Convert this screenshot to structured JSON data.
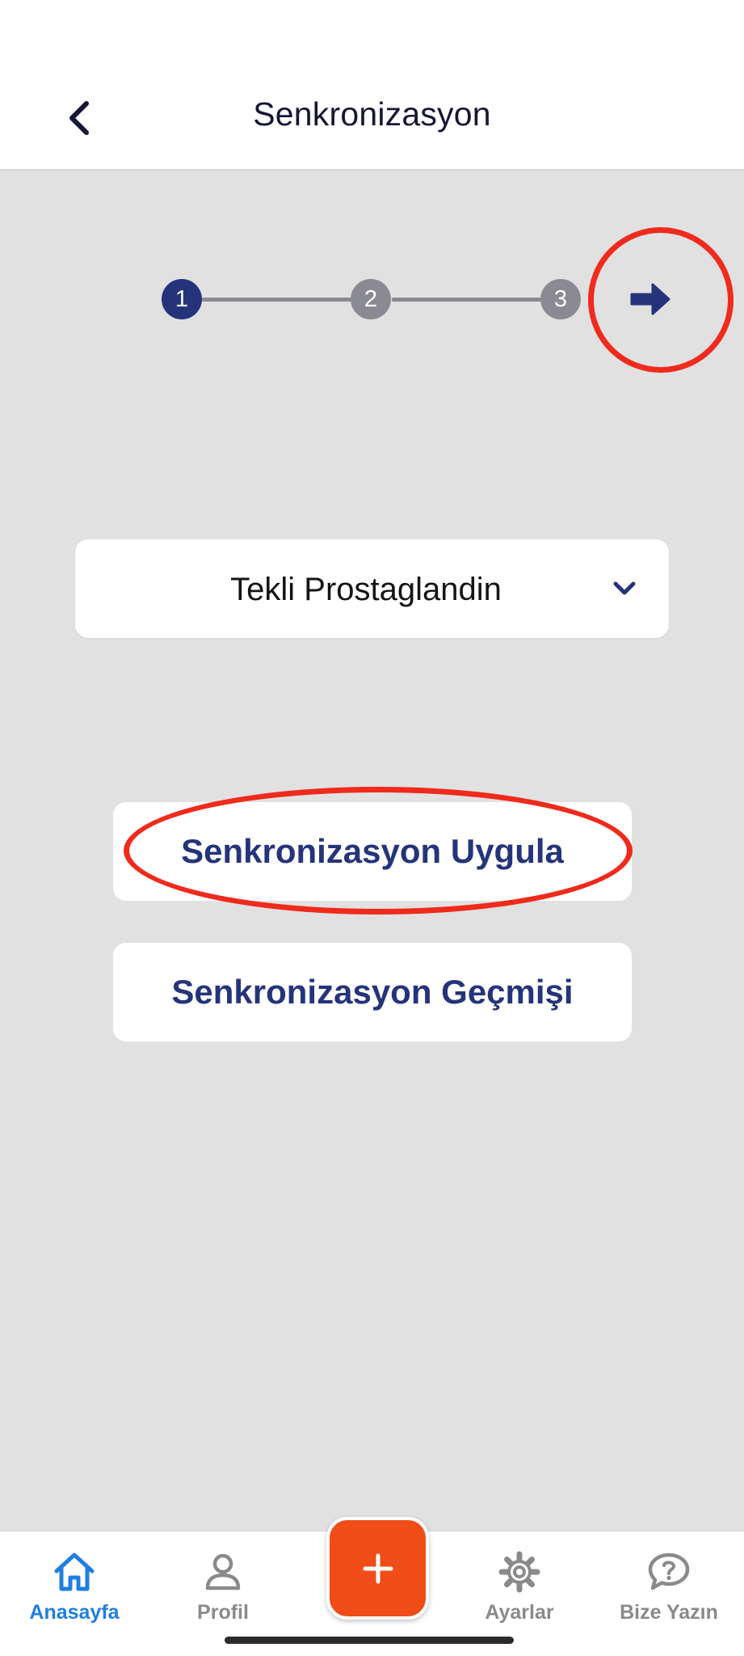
{
  "header": {
    "title": "Senkronizasyon",
    "back_icon": "chevron-left-icon"
  },
  "stepper": {
    "steps": [
      {
        "label": "1",
        "state": "active"
      },
      {
        "label": "2",
        "state": "inactive"
      },
      {
        "label": "3",
        "state": "inactive"
      }
    ],
    "next_icon": "arrow-right-icon"
  },
  "dropdown": {
    "selected": "Tekli Prostaglandin",
    "icon": "chevron-down-icon"
  },
  "actions": {
    "apply_label": "Senkronizasyon Uygula",
    "history_label": "Senkronizasyon Geçmişi"
  },
  "bottom_nav": {
    "items": [
      {
        "label": "Anasayfa",
        "icon": "home-icon",
        "active": true
      },
      {
        "label": "Profil",
        "icon": "user-icon",
        "active": false
      },
      {
        "label": "Ayarlar",
        "icon": "gear-icon",
        "active": false
      },
      {
        "label": "Bize Yazın",
        "icon": "question-chat-icon",
        "active": false
      }
    ],
    "fab_icon": "plus-icon"
  },
  "colors": {
    "primary": "#25347a",
    "accent_orange": "#f04d18",
    "active_nav": "#1f7fe0",
    "inactive": "#8a8a93",
    "annotation_red": "#f02a1c",
    "background": "#e1e1e1"
  }
}
